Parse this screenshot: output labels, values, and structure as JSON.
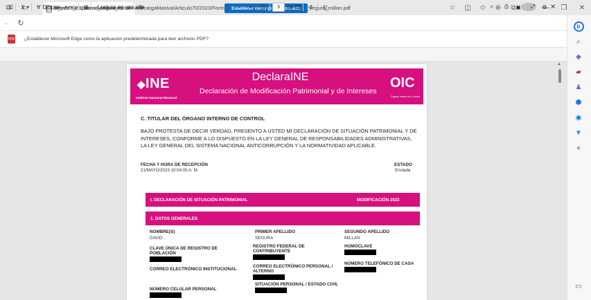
{
  "browser": {
    "tab_title": "tr_mod7_2022david_segura_milla",
    "url": "https://transparencia.ine.mx/sistemaot/cargaMasiva/Articulo70/2023/Formato12/OIC/tml2/tr_mod7_2022david_segura_millan.pdf"
  },
  "infobar": {
    "message": "¿Establecer Microsoft Edge como la aplicación predeterminada para leer archivos PDF?",
    "button": "Establecer como predeterminado"
  },
  "pdf_toolbar": {
    "draw_label": "Dibujar",
    "read_aloud": "Lectura en voz alta",
    "page_current": "3",
    "page_total": "de 22"
  },
  "document": {
    "header": {
      "ine": "INE",
      "ine_sub": "Instituto Nacional Electoral",
      "brand": "DeclaraINE",
      "title": "Declaración de Modificación Patrimonial y de Intereses",
      "oic": "OIC",
      "oic_sub": "Órgano Interno de Control"
    },
    "section_c": "C. TITULAR DEL ÓRGANO INTERNO DE CONTROL",
    "statement": "BAJO PROTESTA DE DECIR VERDAD, PRESENTO A USTED MI DECLARACIÓN DE SITUACIÓN PATRIMONIAL Y DE INTERESES, CONFORME A LO DISPUESTO EN LA LEY GENERAL DE RESPONSABILIDADES ADMINISTRATIVAS, LA LEY GENERAL DEL SISTEMA NACIONAL ANTICORRUPCIÓN Y LA NORMATIVIDAD APLICABLE.",
    "fecha_label": "FECHA Y HORA DE RECEPCIÓN",
    "fecha_value": "21/MAYO/2023 10:54:05 A. M.",
    "estado_label": "ESTADO",
    "estado_value": "Enviada",
    "bar1_left": "I. DECLARACIÓN DE SITUACIÓN PATRIMONIAL",
    "bar1_right": "MODIFICACIÓN 2022",
    "bar2": "1. DATOS GENERALES",
    "fields": {
      "nombre_label": "NOMBRE(S)",
      "nombre_value": "DAVID",
      "primer_label": "PRIMER APELLIDO",
      "primer_value": "SEGURA",
      "segundo_label": "SEGUNDO APELLIDO",
      "segundo_value": "MILLAN",
      "curp_label_1": "CLAVE ÚNICA DE REGISTRO DE",
      "curp_label_2": "POBLACIÓN",
      "rfc_label_1": "REGISTRO FEDERAL DE",
      "rfc_label_2": "CONTRIBUYENTE",
      "homoclave_label": "HOMOCLAVE",
      "correo_inst_label": "CORREO ELECTRÓNICO INSTITUCIONAL",
      "correo_pers_label_1": "CORREO ELECTRÓNICO PERSONAL /",
      "correo_pers_label_2": "ALTERNO",
      "tel_casa_label": "NÚMERO TELEFÓNICO DE CASA",
      "celular_label": "NÚMERO CELULAR PERSONAL",
      "situacion_label": "SITUACIÓN PERSONAL / ESTADO CIVIL"
    }
  },
  "colors": {
    "ine_magenta": "#d6107e",
    "edge_blue": "#0f6cbd"
  }
}
